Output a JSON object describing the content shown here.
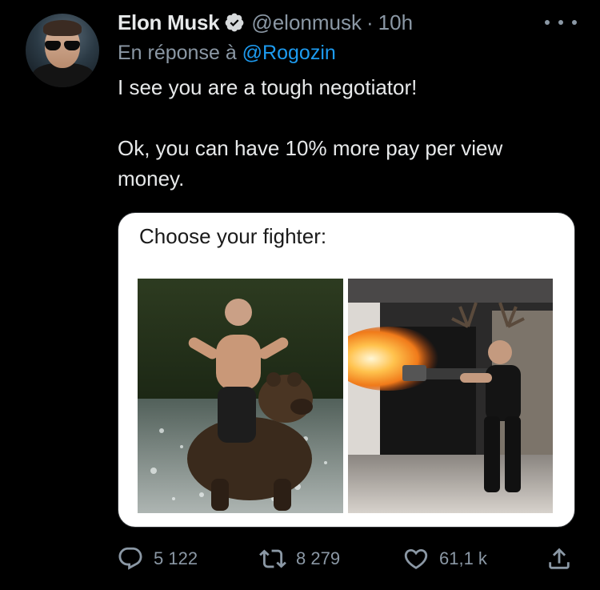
{
  "author": {
    "name": "Elon Musk",
    "handle": "@elonmusk",
    "separator": "·",
    "time": "10h"
  },
  "reply": {
    "prefix": "En réponse à",
    "mention": "@Rogozin"
  },
  "text": {
    "line1": "I see you are a tough negotiator!",
    "line2": "Ok, you can have 10% more pay per view money."
  },
  "media": {
    "caption": "Choose your fighter:"
  },
  "actions": {
    "replies": "5 122",
    "retweets": "8 279",
    "likes": "61,1 k"
  },
  "colors": {
    "background": "#000000",
    "text": "#e7e9ea",
    "secondary": "#8b98a5",
    "accent": "#1d9bf0"
  },
  "icons": [
    "verified-badge-icon",
    "more-dots-icon",
    "reply-icon",
    "retweet-icon",
    "like-heart-icon",
    "share-icon"
  ]
}
